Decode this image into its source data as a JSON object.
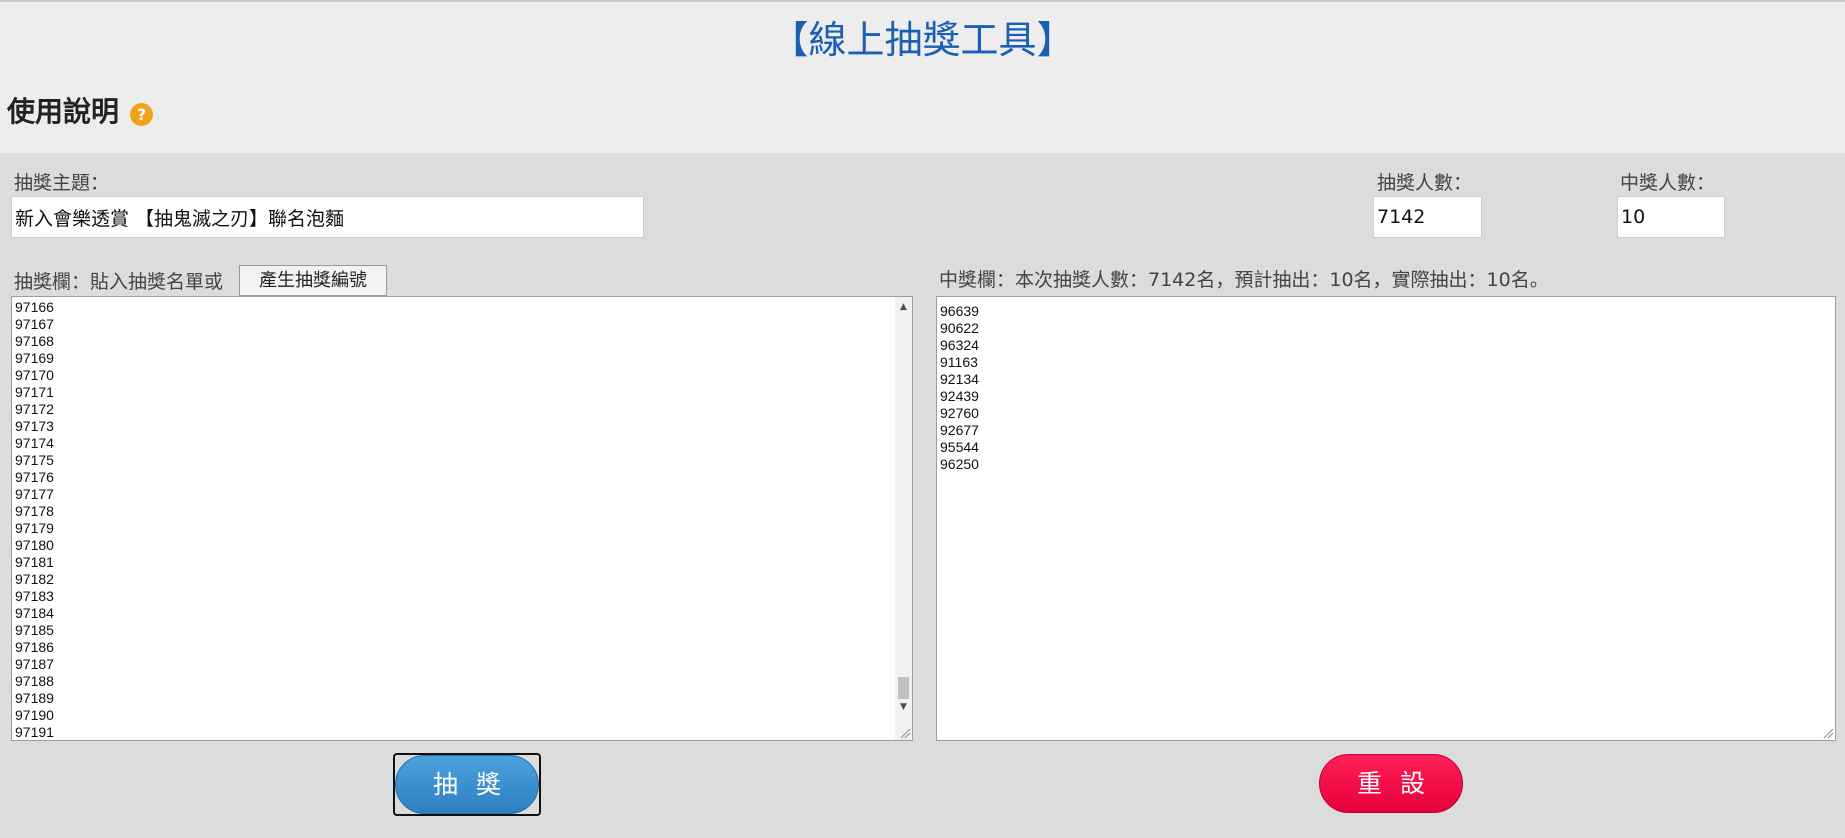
{
  "page": {
    "title": "【線上抽獎工具】",
    "help_title": "使用說明",
    "help_icon": "?"
  },
  "form": {
    "topic_label": "抽獎主題：",
    "topic_value": "新入會樂透賞 【抽鬼滅之刃】聯名泡麵",
    "entrants_label": "抽獎人數：",
    "entrants_value": "7142",
    "winners_label": "中獎人數：",
    "winners_value": "10"
  },
  "draw_panel": {
    "label": "抽獎欄：貼入抽獎名單或",
    "generate_button": "產生抽獎編號",
    "lines": [
      "97166",
      "97167",
      "97168",
      "97169",
      "97170",
      "97171",
      "97172",
      "97173",
      "97174",
      "97175",
      "97176",
      "97177",
      "97178",
      "97179",
      "97180",
      "97181",
      "97182",
      "97183",
      "97184",
      "97185",
      "97186",
      "97187",
      "97188",
      "97189",
      "97190",
      "97191"
    ]
  },
  "winner_panel": {
    "label": "中獎欄：本次抽獎人數：7142名，預計抽出：10名，實際抽出：10名。",
    "lines": [
      "96639",
      "90622",
      "96324",
      "91163",
      "92134",
      "92439",
      "92760",
      "92677",
      "95544",
      "96250"
    ]
  },
  "buttons": {
    "draw": "抽獎",
    "reset": "重設"
  },
  "colors": {
    "title": "#1a5fb4",
    "help_icon": "#f0a21a",
    "draw_button": "#3a8fd0",
    "reset_button": "#f2084a"
  },
  "icons": {
    "help": "question-circle-icon",
    "scroll_up": "triangle-up-icon",
    "scroll_down": "triangle-down-icon",
    "resize": "resize-grip-icon"
  }
}
